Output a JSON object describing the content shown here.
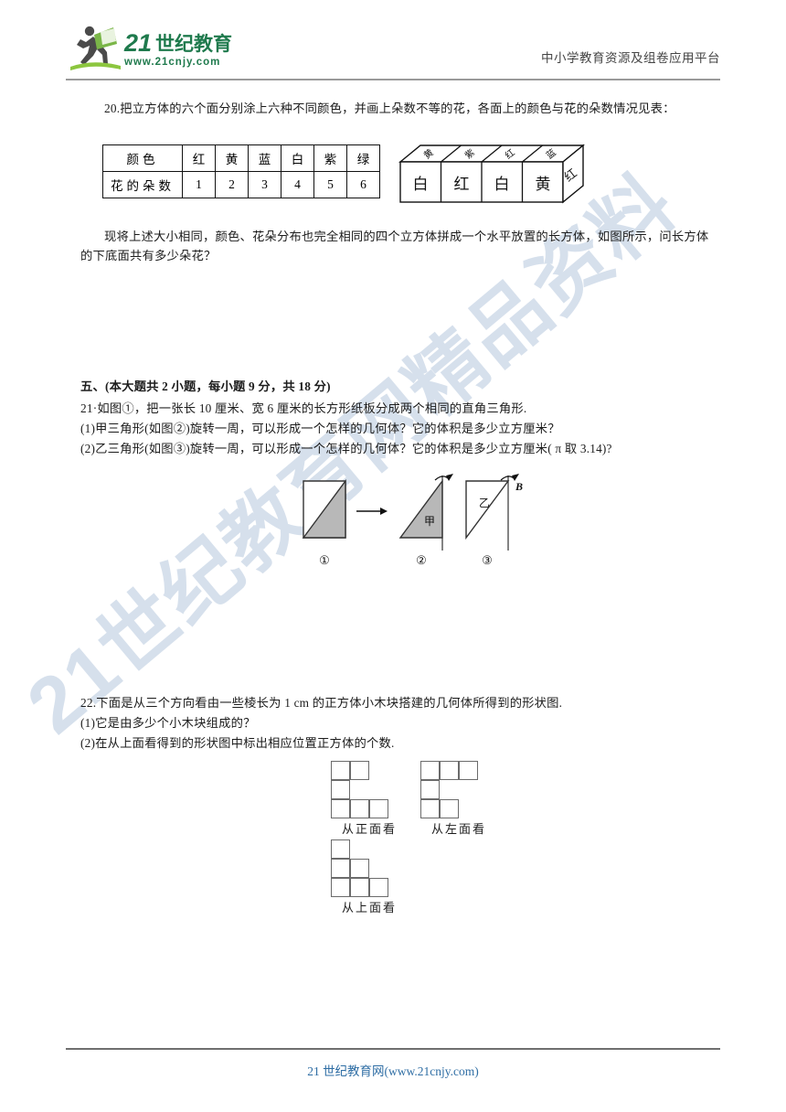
{
  "header": {
    "logo_main": "21世纪教育",
    "logo_url": "www.21cnjy.com",
    "tagline": "中小学教育资源及组卷应用平台"
  },
  "watermark": {
    "text": "21世纪教育网精品资料"
  },
  "q20": {
    "stem": "20.把立方体的六个面分别涂上六种不同颜色，并画上朵数不等的花，各面上的颜色与花的朵数情况见表：",
    "table": {
      "row_labels": [
        "颜色",
        "花的朵数"
      ],
      "colors": [
        "红",
        "黄",
        "蓝",
        "白",
        "紫",
        "绿"
      ],
      "counts": [
        "1",
        "2",
        "3",
        "4",
        "5",
        "6"
      ]
    },
    "figure": {
      "front_faces": [
        "白",
        "红",
        "白",
        "黄"
      ],
      "top_faces": [
        "黄",
        "紫",
        "红",
        "蓝"
      ],
      "right_face": "红"
    },
    "body": "现将上述大小相同，颜色、花朵分布也完全相同的四个立方体拼成一个水平放置的长方体，如图所示，问长方体的下底面共有多少朵花？"
  },
  "section5": {
    "heading": "五、(本大题共 2 小题，每小题 9 分，共 18 分)",
    "q21": {
      "stem": "21·如图①，把一张长 10 厘米、宽 6 厘米的长方形纸板分成两个相同的直角三角形.",
      "part1": "(1)甲三角形(如图②)旋转一周，可以形成一个怎样的几何体？它的体积是多少立方厘米？",
      "part2": "(2)乙三角形(如图③)旋转一周，可以形成一个怎样的几何体？它的体积是多少立方厘米( π 取 3.14)?",
      "figure_labels": [
        "①",
        "②",
        "③"
      ],
      "triangle_jia": "甲",
      "triangle_yi": "乙",
      "point_b": "B"
    },
    "q22": {
      "stem": "22.下面是从三个方向看由一些棱长为 1 cm 的正方体小木块搭建的几何体所得到的形状图.",
      "part1": "(1)它是由多少个小木块组成的？",
      "part2": "(2)在从上面看得到的形状图中标出相应位置正方体的个数.",
      "views": [
        {
          "caption": "从正面看",
          "cells": [
            [
              0,
              0
            ],
            [
              0,
              1
            ],
            [
              0,
              2
            ],
            [
              1,
              0
            ],
            [
              1,
              2
            ],
            [
              2,
              0
            ]
          ]
        },
        {
          "caption": "从左面看",
          "cells": [
            [
              0,
              0
            ],
            [
              0,
              1
            ],
            [
              0,
              2
            ],
            [
              1,
              0
            ],
            [
              1,
              2
            ],
            [
              2,
              2
            ]
          ]
        },
        {
          "caption": "从上面看",
          "cells": [
            [
              0,
              0
            ],
            [
              0,
              1
            ],
            [
              0,
              2
            ],
            [
              1,
              0
            ],
            [
              1,
              1
            ],
            [
              2,
              0
            ]
          ]
        }
      ]
    }
  },
  "footer": {
    "text": "21 世纪教育网(www.21cnjy.com)"
  }
}
